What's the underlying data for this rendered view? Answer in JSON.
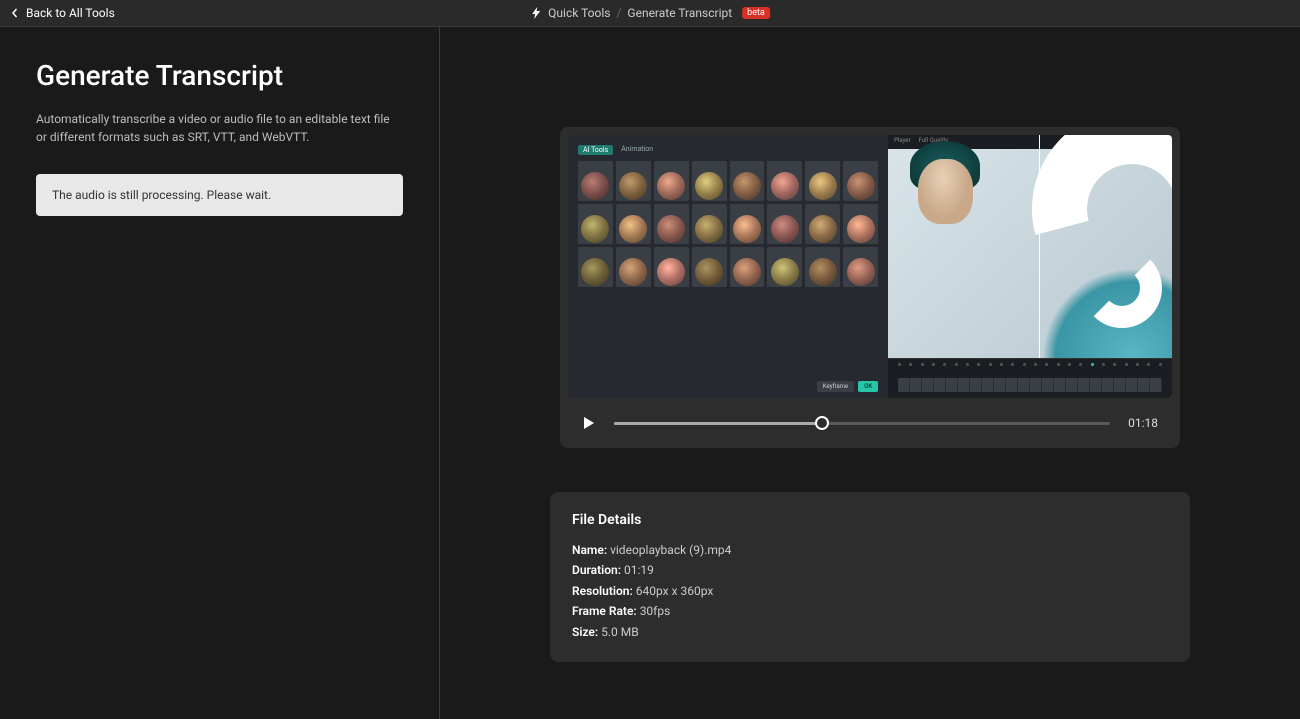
{
  "topbar": {
    "back_label": "Back to All Tools",
    "breadcrumb_root": "Quick Tools",
    "breadcrumb_current": "Generate Transcript",
    "badge": "beta"
  },
  "sidebar": {
    "title": "Generate Transcript",
    "description": "Automatically transcribe a video or audio file to an editable text file or different formats such as SRT, VTT, and WebVTT.",
    "processing_message": "The audio is still processing. Please wait."
  },
  "player": {
    "current_time_label": "01:18"
  },
  "details": {
    "heading": "File Details",
    "rows": [
      {
        "label": "Name:",
        "value": "videoplayback (9).mp4"
      },
      {
        "label": "Duration:",
        "value": "01:19"
      },
      {
        "label": "Resolution:",
        "value": "640px x 360px"
      },
      {
        "label": "Frame Rate:",
        "value": "30fps"
      },
      {
        "label": "Size:",
        "value": "5.0 MB"
      }
    ]
  },
  "thumb": {
    "tab_active": "AI Tools",
    "tab_other": "Animation",
    "preview_header_left": "Player",
    "preview_header_right": "Full Quality"
  }
}
